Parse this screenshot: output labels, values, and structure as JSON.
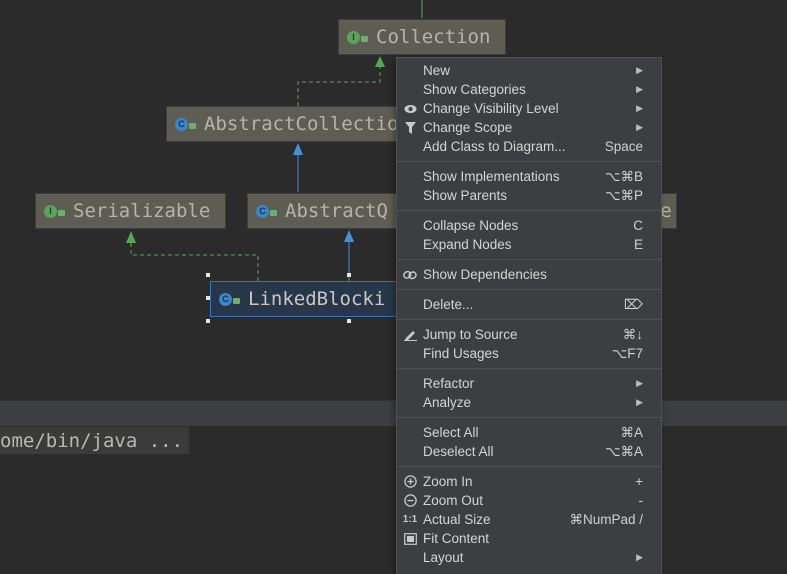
{
  "diagram": {
    "nodes": {
      "collection": {
        "label": "Collection",
        "kind": "I"
      },
      "abstract_collection": {
        "label": "AbstractCollectio",
        "kind": "C"
      },
      "serializable": {
        "label": "Serializable",
        "kind": "I"
      },
      "abstract_queue": {
        "label": "AbstractQ",
        "kind": "C"
      },
      "linked_blocking": {
        "label": "LinkedBlocki",
        "kind": "C"
      },
      "partial_node": {
        "label": "e"
      }
    }
  },
  "console": {
    "line": "ome/bin/java ..."
  },
  "menu": {
    "groups": [
      [
        {
          "label": "New",
          "submenu": true
        },
        {
          "label": "Show Categories",
          "submenu": true
        },
        {
          "label": "Change Visibility Level",
          "submenu": true,
          "icon": "eye-icon"
        },
        {
          "label": "Change Scope",
          "submenu": true,
          "icon": "filter-icon"
        },
        {
          "label": "Add Class to Diagram...",
          "shortcut": "Space"
        }
      ],
      [
        {
          "label": "Show Implementations",
          "shortcut": "⌥⌘B"
        },
        {
          "label": "Show Parents",
          "shortcut": "⌥⌘P"
        }
      ],
      [
        {
          "label": "Collapse Nodes",
          "shortcut": "C"
        },
        {
          "label": "Expand Nodes",
          "shortcut": "E"
        }
      ],
      [
        {
          "label": "Show Dependencies",
          "icon": "link-icon"
        }
      ],
      [
        {
          "label": "Delete...",
          "shortcut": "⌦"
        }
      ],
      [
        {
          "label": "Jump to Source",
          "shortcut": "⌘↓",
          "icon": "pencil-icon"
        },
        {
          "label": "Find Usages",
          "shortcut": "⌥F7"
        }
      ],
      [
        {
          "label": "Refactor",
          "submenu": true
        },
        {
          "label": "Analyze",
          "submenu": true
        }
      ],
      [
        {
          "label": "Select All",
          "shortcut": "⌘A"
        },
        {
          "label": "Deselect All",
          "shortcut": "⌥⌘A"
        }
      ],
      [
        {
          "label": "Zoom In",
          "shortcut": "+",
          "icon": "zoom-in-icon"
        },
        {
          "label": "Zoom Out",
          "shortcut": "-",
          "icon": "zoom-out-icon"
        },
        {
          "label": "Actual Size",
          "shortcut": "⌘NumPad /",
          "icon": "actual-size-icon"
        },
        {
          "label": "Fit Content",
          "icon": "fit-content-icon"
        },
        {
          "label": "Layout",
          "submenu": true
        }
      ]
    ]
  }
}
